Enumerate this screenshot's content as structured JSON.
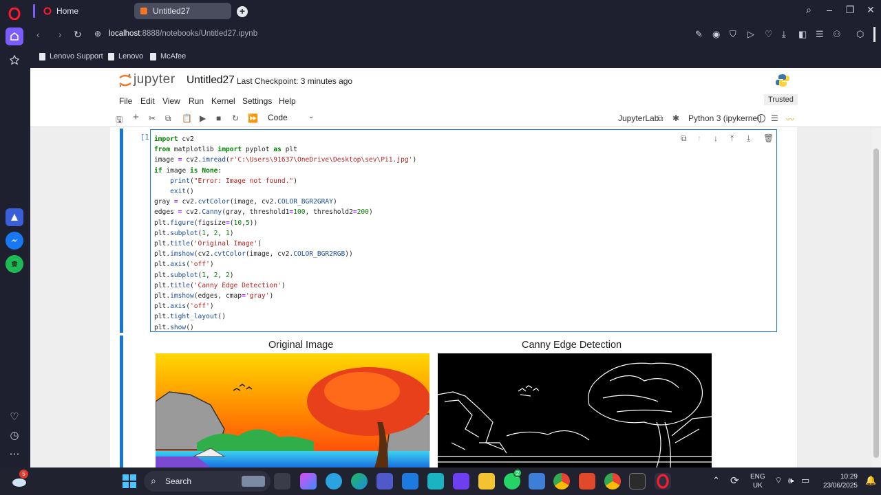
{
  "browser": {
    "tabs": [
      {
        "label": "Home"
      },
      {
        "label": "Untitled27"
      }
    ],
    "address": {
      "host": "localhost",
      "path": ":8888/notebooks/Untitled27.ipynb"
    },
    "bookmarks": [
      "Lenovo Support",
      "Lenovo",
      "McAfee"
    ]
  },
  "jupyter": {
    "logo_text": "jupyter",
    "notebook_name": "Untitled27",
    "checkpoint": "Last Checkpoint: 3 minutes ago",
    "trusted": "Trusted",
    "menu": [
      "File",
      "Edit",
      "View",
      "Run",
      "Kernel",
      "Settings",
      "Help"
    ],
    "cell_type": "Code",
    "jupyterlab_label": "JupyterLab",
    "kernel": "Python 3 (ipykernel)",
    "cell_prompt": "[1]:"
  },
  "code_lines": [
    "import cv2",
    "from matplotlib import pyplot as plt",
    "image = cv2.imread(r'C:\\Users\\91637\\OneDrive\\Desktop\\sev\\Pi1.jpg')",
    "if image is None:",
    "    print(\"Error: Image not found.\")",
    "    exit()",
    "gray = cv2.cvtColor(image, cv2.COLOR_BGR2GRAY)",
    "edges = cv2.Canny(gray, threshold1=100, threshold2=200)",
    "plt.figure(figsize=(10,5))",
    "plt.subplot(1, 2, 1)",
    "plt.title('Original Image')",
    "plt.imshow(cv2.cvtColor(image, cv2.COLOR_BGR2RGB))",
    "plt.axis('off')",
    "plt.subplot(1, 2, 2)",
    "plt.title('Canny Edge Detection')",
    "plt.imshow(edges, cmap='gray')",
    "plt.axis('off')",
    "plt.tight_layout()",
    "plt.show()"
  ],
  "output": {
    "left_title": "Original Image",
    "right_title": "Canny Edge Detection"
  },
  "taskbar": {
    "search_label": "Search",
    "lang": "ENG",
    "region": "UK",
    "time": "10:29",
    "date": "23/06/2025",
    "notif_badge": "5",
    "whatsapp_badge": "2"
  },
  "colors": {
    "accent": "#1976d2",
    "jupyter_orange": "#f37726",
    "opera_red": "#ff1b2d"
  }
}
